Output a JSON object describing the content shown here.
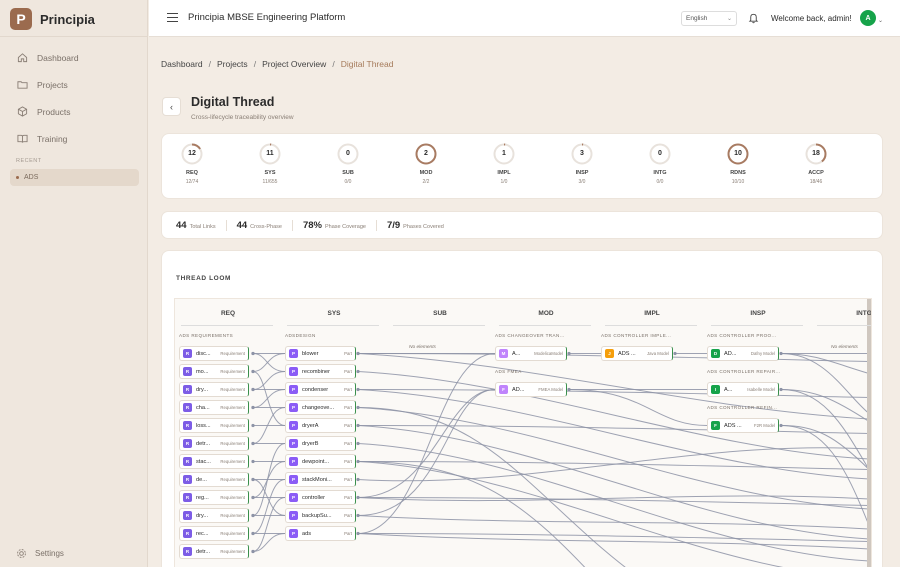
{
  "app": {
    "name": "Principia",
    "logo_letter": "P",
    "platform_title": "Principia MBSE Engineering Platform"
  },
  "sidebar": {
    "items": [
      {
        "label": "Dashboard",
        "icon": "home-icon"
      },
      {
        "label": "Projects",
        "icon": "folder-icon"
      },
      {
        "label": "Products",
        "icon": "box-icon"
      },
      {
        "label": "Training",
        "icon": "book-icon"
      }
    ],
    "recent_label": "RECENT",
    "recent_items": [
      "ADS"
    ],
    "settings_label": "Settings"
  },
  "topbar": {
    "language": "English",
    "welcome": "Welcome back, admin!",
    "avatar_letter": "A"
  },
  "breadcrumb": [
    "Dashboard",
    "Projects",
    "Project Overview",
    "Digital Thread"
  ],
  "page": {
    "title": "Digital Thread",
    "subtitle": "Cross-lifecycle traceability overview"
  },
  "phases": [
    {
      "code": "REQ",
      "count": "12",
      "fraction": "12/74",
      "progress": 0.16
    },
    {
      "code": "SYS",
      "count": "11",
      "fraction": "11/655",
      "progress": 0.02
    },
    {
      "code": "SUB",
      "count": "0",
      "fraction": "0/0",
      "progress": 0
    },
    {
      "code": "MOD",
      "count": "2",
      "fraction": "2/2",
      "progress": 1
    },
    {
      "code": "IMPL",
      "count": "1",
      "fraction": "1/0",
      "progress": 0.02
    },
    {
      "code": "INSP",
      "count": "3",
      "fraction": "3/0",
      "progress": 0.02
    },
    {
      "code": "INTG",
      "count": "0",
      "fraction": "0/0",
      "progress": 0
    },
    {
      "code": "RDNS",
      "count": "10",
      "fraction": "10/10",
      "progress": 1
    },
    {
      "code": "ACCP",
      "count": "18",
      "fraction": "18/46",
      "progress": 0.39
    }
  ],
  "stats": [
    {
      "value": "44",
      "label": "Total Links"
    },
    {
      "value": "44",
      "label": "Cross-Phase"
    },
    {
      "value": "78%",
      "label": "Phase Coverage"
    },
    {
      "value": "7/9",
      "label": "Phases Covered"
    }
  ],
  "loom": {
    "title": "THREAD LOOM",
    "columns": [
      "REQ",
      "SYS",
      "SUB",
      "MOD",
      "IMPL",
      "INSP",
      "INTG"
    ],
    "no_elements": "No elements",
    "req": {
      "group": "ADS REQUIREMENTS",
      "type": "Requirement",
      "badge": "R",
      "items": [
        "disc...",
        "mo...",
        "dry...",
        "cha...",
        "loss...",
        "detr...",
        "stac...",
        "de...",
        "reg...",
        "dry...",
        "rec...",
        "detr..."
      ]
    },
    "sys": {
      "group": "ADSDESIGN",
      "type": "Part",
      "badge": "P",
      "items": [
        "blower",
        "recombiner",
        "condenser",
        "changeove...",
        "dryerA",
        "dryerB",
        "dewpoint...",
        "stackMoni...",
        "controller",
        "backupSu...",
        "ads"
      ]
    },
    "mod": [
      {
        "group": "ADS CHANGEOVER TRAN...",
        "name": "A...",
        "type": "ModelicaModel",
        "badge": "M"
      },
      {
        "group": "ADS FMEA",
        "name": "AD...",
        "type": "FMEA Model",
        "badge": "F"
      }
    ],
    "impl": [
      {
        "group": "ADS CONTROLLER IMPLE...",
        "name": "ADS ...",
        "type": "Java Model",
        "badge": "J"
      }
    ],
    "insp": [
      {
        "group": "ADS CONTROLLER PROO...",
        "name": "AD...",
        "type": "Dafny Model",
        "badge": "D"
      },
      {
        "group": "ADS CONTROLLER REPAIR...",
        "name": "A...",
        "type": "Isabelle Model",
        "badge": "I"
      },
      {
        "group": "ADS CONTROLLER REFIN...",
        "name": "ADS ...",
        "type": "F2R Model",
        "badge": "F"
      }
    ]
  },
  "colors": {
    "accent": "#9b6b4e",
    "req_badge": "#7c5ce6",
    "sys_badge": "#8b5cf6",
    "mod_badge": "#c084fc",
    "impl_badge": "#f59e0b",
    "insp_badge": "#16a34a",
    "thread": "#8d93a6",
    "ring": "#a87b62"
  }
}
